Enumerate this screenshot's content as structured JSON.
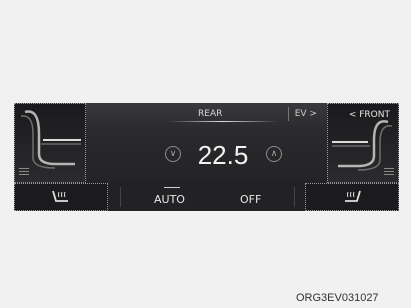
{
  "climate_panel": {
    "rear_label": "REAR",
    "ev_label": "EV >",
    "front_label": "< FRONT",
    "temperature": "22.5",
    "auto_label": "AUTO",
    "off_label": "OFF"
  },
  "caption": "ORG3EV031027",
  "colors": {
    "panel_bg": "#2a2a2c",
    "text": "#f2f2f2",
    "page_bg": "#f1f1f1"
  },
  "icons": [
    "seat-left-icon",
    "seat-right-icon",
    "temp-down-icon",
    "temp-up-icon",
    "seat-heater-left-icon",
    "seat-heater-right-icon",
    "menu-icon"
  ]
}
